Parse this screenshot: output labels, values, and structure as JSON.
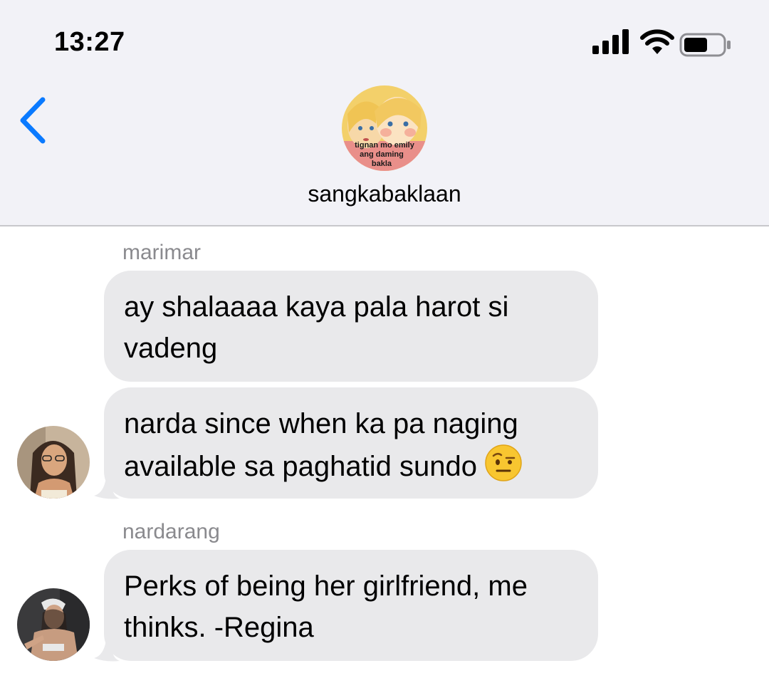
{
  "status_bar": {
    "time": "13:27"
  },
  "header": {
    "group_name": "sangkabaklaan",
    "avatar_caption_line1": "tignan mo emily",
    "avatar_caption_line2": "ang daming",
    "avatar_caption_line3": "bakla"
  },
  "messages": [
    {
      "sender": "marimar",
      "text": "ay shalaaaa kaya pala harot si vadeng"
    },
    {
      "sender": "",
      "text": "narda since when ka pa naging available sa paghatid sundo",
      "emoji": "face-with-raised-eyebrow"
    },
    {
      "sender": "nardarang",
      "text": "Perks of being her girlfriend, me thinks. -Regina"
    }
  ],
  "colors": {
    "header_bg": "#f2f2f7",
    "bubble_bg": "#e9e9eb",
    "accent": "#0a7aff",
    "sender_text": "#8a8a8e"
  }
}
